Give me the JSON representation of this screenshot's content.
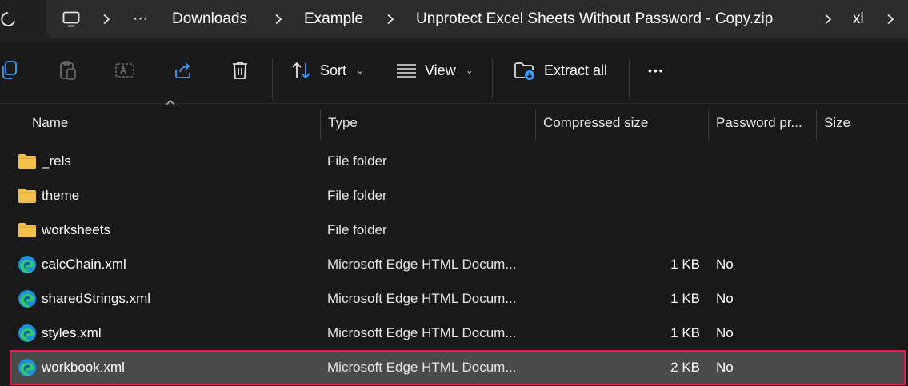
{
  "address_bar": {
    "more_label": "···",
    "crumbs": [
      "Downloads",
      "Example",
      "Unprotect Excel Sheets Without Password - Copy.zip",
      "xl"
    ]
  },
  "toolbar": {
    "sort_label": "Sort",
    "view_label": "View",
    "extract_label": "Extract all",
    "more_label": "•••"
  },
  "columns": {
    "name": "Name",
    "type": "Type",
    "compressed_size": "Compressed size",
    "password": "Password pr...",
    "size": "Size"
  },
  "rows": [
    {
      "name": "_rels",
      "type": "File folder",
      "compressed": "",
      "password": "",
      "icon": "folder-icon"
    },
    {
      "name": "theme",
      "type": "File folder",
      "compressed": "",
      "password": "",
      "icon": "folder-icon"
    },
    {
      "name": "worksheets",
      "type": "File folder",
      "compressed": "",
      "password": "",
      "icon": "folder-icon"
    },
    {
      "name": "calcChain.xml",
      "type": "Microsoft Edge HTML Docum...",
      "compressed": "1 KB",
      "password": "No",
      "icon": "edge-icon"
    },
    {
      "name": "sharedStrings.xml",
      "type": "Microsoft Edge HTML Docum...",
      "compressed": "1 KB",
      "password": "No",
      "icon": "edge-icon"
    },
    {
      "name": "styles.xml",
      "type": "Microsoft Edge HTML Docum...",
      "compressed": "1 KB",
      "password": "No",
      "icon": "edge-icon"
    },
    {
      "name": "workbook.xml",
      "type": "Microsoft Edge HTML Docum...",
      "compressed": "2 KB",
      "password": "No",
      "icon": "edge-icon",
      "selected": true
    }
  ],
  "colors": {
    "background": "#191919",
    "selected_row": "#4a4a4a",
    "highlight_border": "#e0234e",
    "folder": "#f3c14c"
  }
}
